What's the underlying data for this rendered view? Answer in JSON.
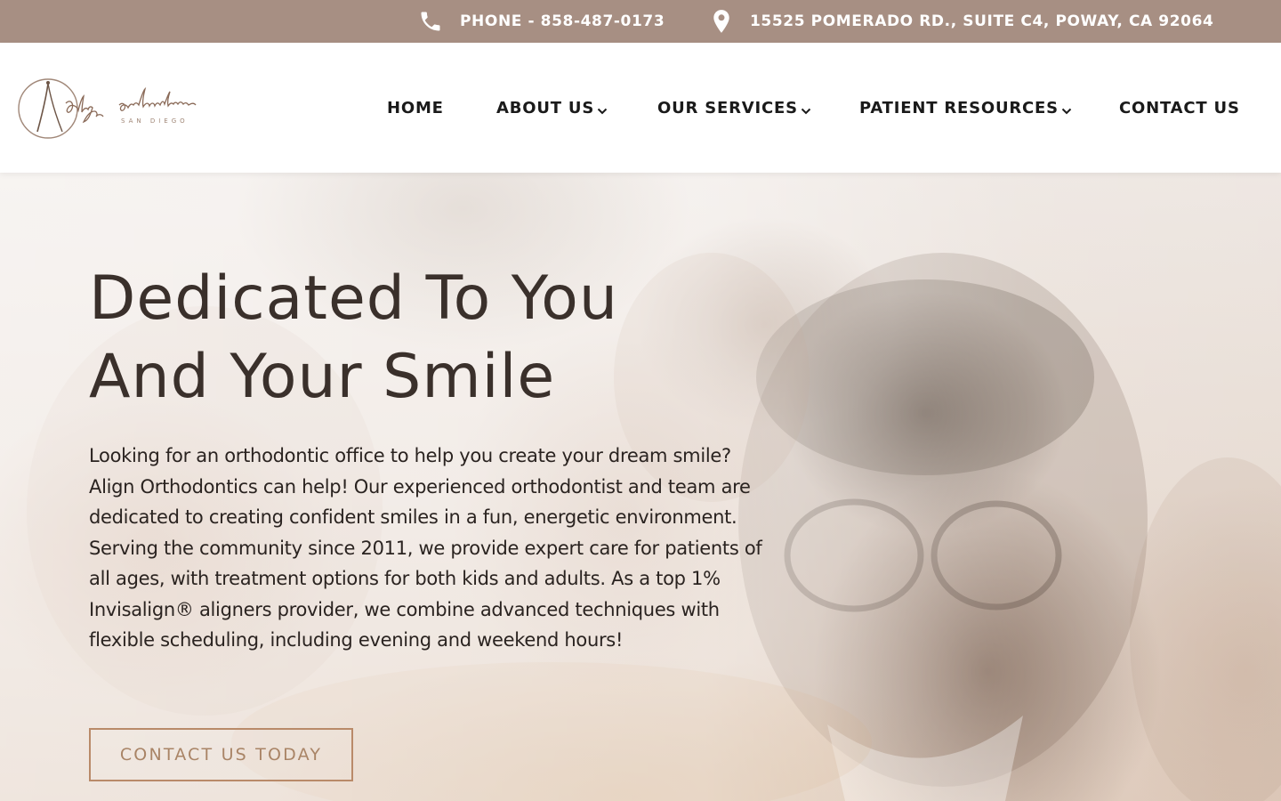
{
  "topbar": {
    "phone": "PHONE - 858-487-0173",
    "address": "15525 POMERADO RD., SUITE C4, POWAY, CA 92064",
    "phone_icon": "phone-icon",
    "address_icon": "map-pin-icon"
  },
  "header": {
    "logo_icon": "align-orthodontics-logo",
    "nav": {
      "home": "HOME",
      "about": "ABOUT US",
      "services": "OUR SERVICES",
      "resources": "PATIENT RESOURCES",
      "contact": "CONTACT US"
    },
    "dropdown_icon": "chevron-down-icon"
  },
  "hero": {
    "title_line1": "Dedicated To You",
    "title_line2": "And Your Smile",
    "body": "Looking for an orthodontic office to help you create your dream smile? Align Orthodontics can help! Our experienced orthodontist and team are dedicated to creating confident smiles in a fun, energetic environment. Serving the community since 2011, we provide expert care for patients of all ages, with treatment options for both kids and adults. As a top 1% Invisalign® aligners provider, we combine advanced techniques with flexible scheduling, including evening and weekend hours!",
    "cta_label": "CONTACT US TODAY"
  },
  "colors": {
    "topbar_bg": "#a78f83",
    "accent": "#b98a69",
    "heading": "#3a302b",
    "nav_text": "#1a1a1a"
  }
}
